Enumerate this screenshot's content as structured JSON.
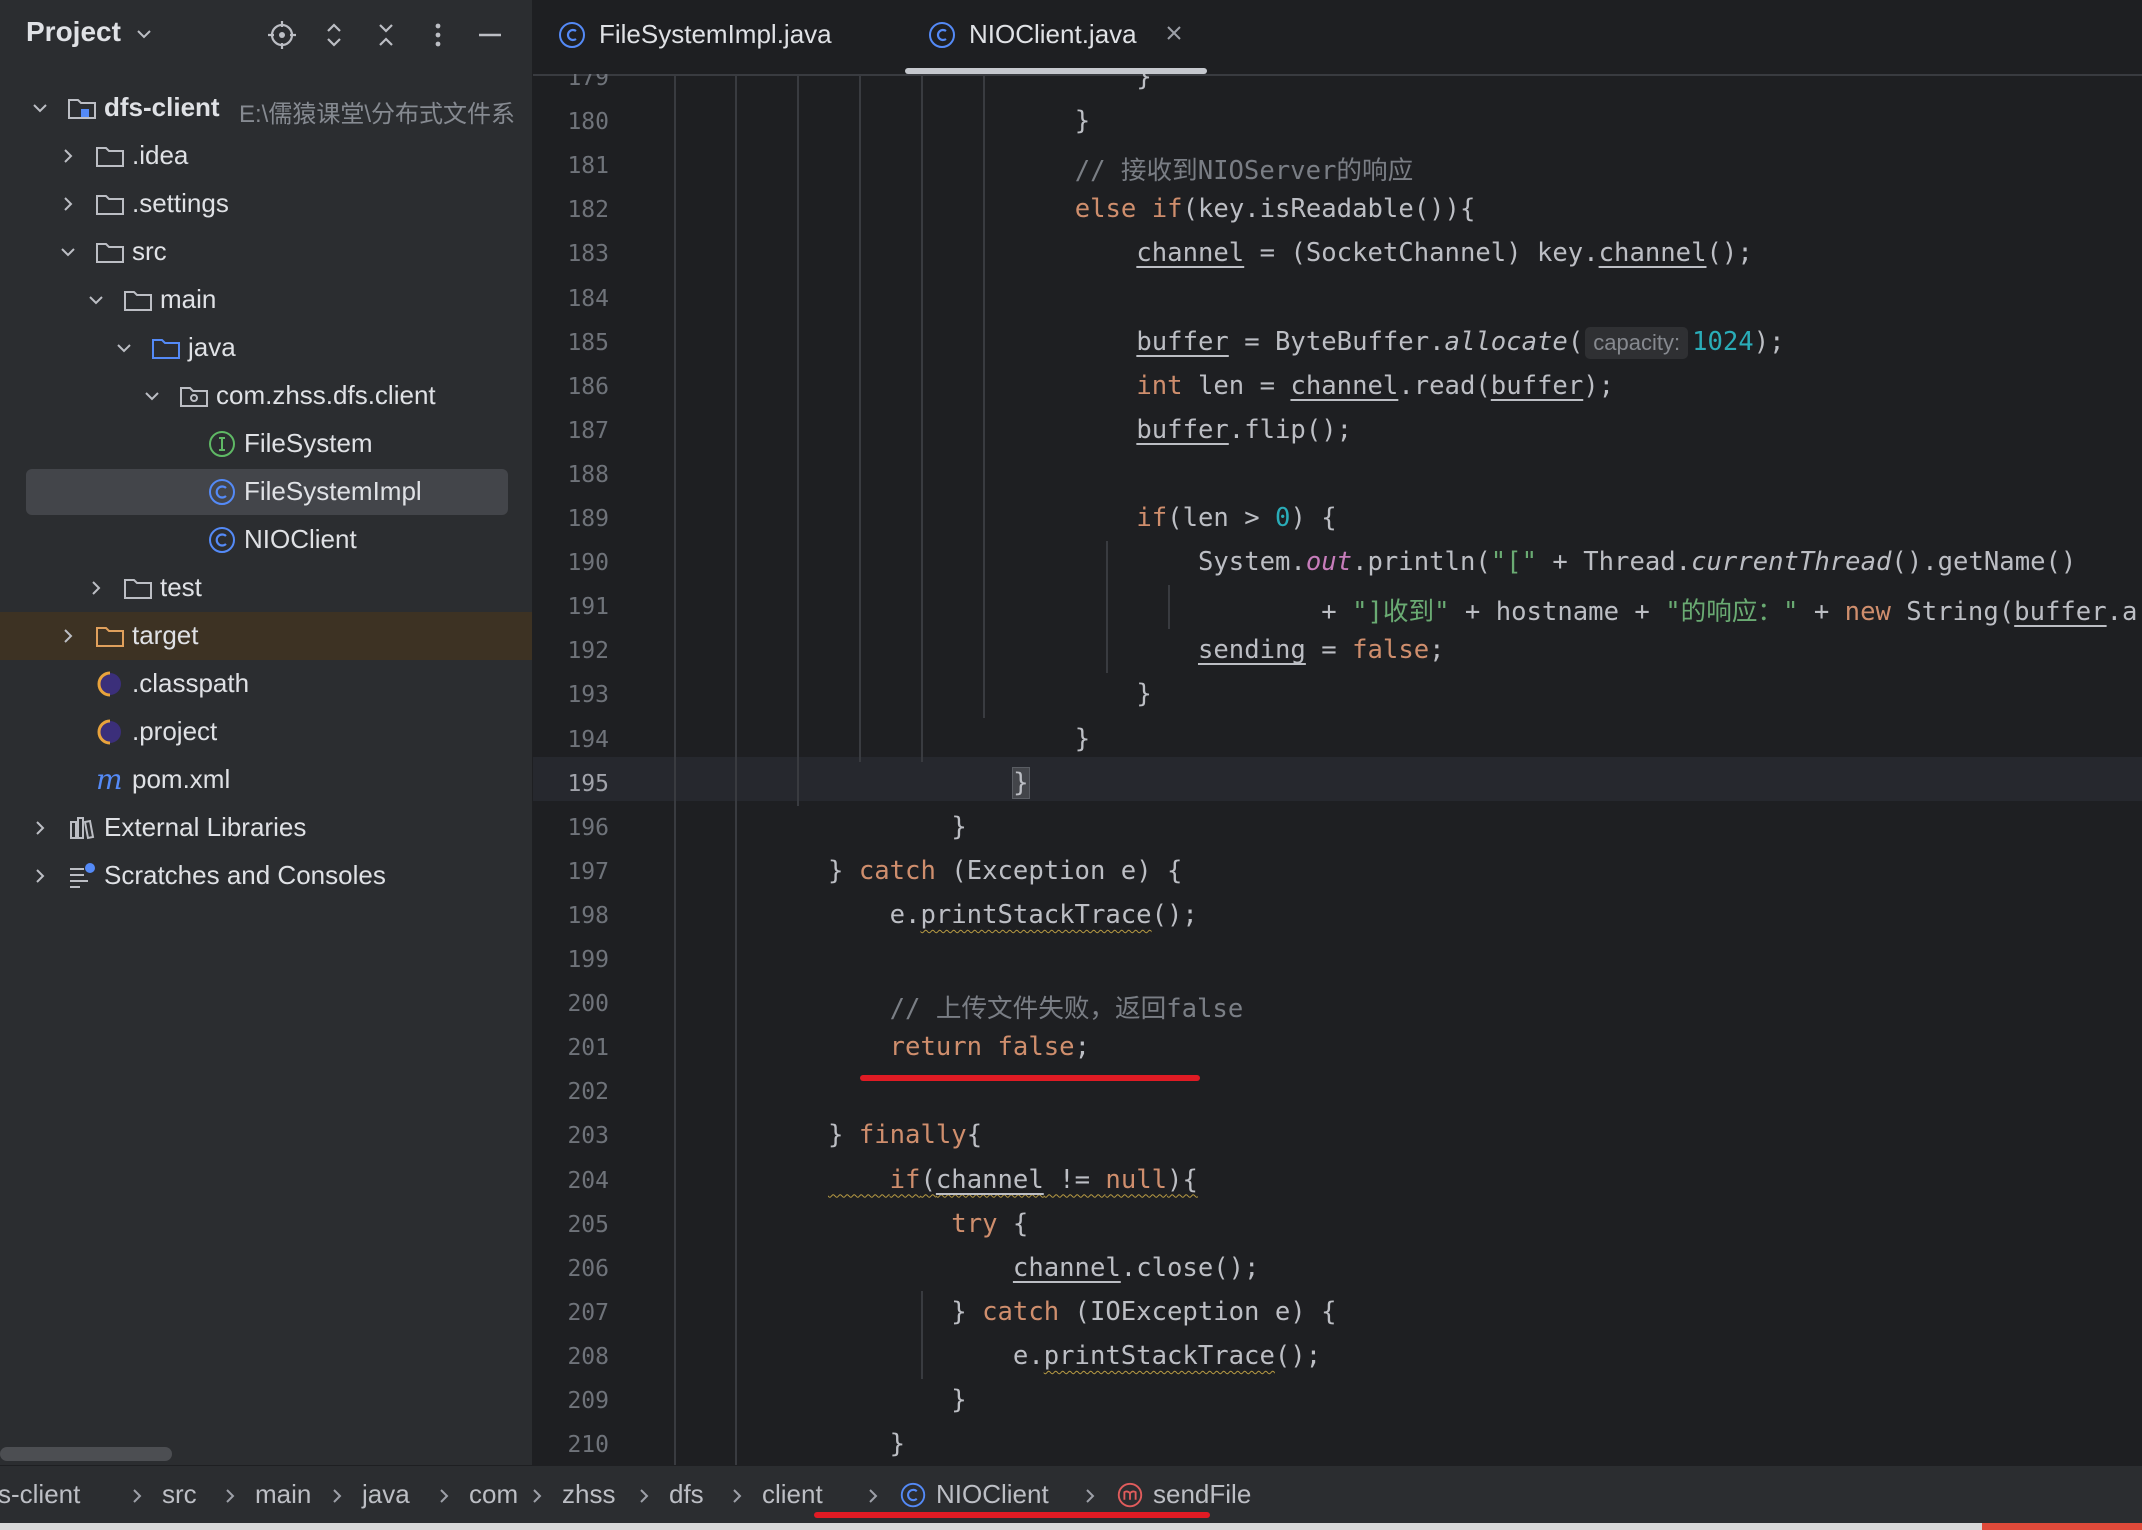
{
  "project_panel": {
    "title": "Project",
    "header_icons": [
      "locate-icon",
      "expand-all-icon",
      "collapse-all-icon",
      "more-icon",
      "hide-icon"
    ],
    "tree": [
      {
        "label": "dfs-client",
        "path": "E:\\儒猿课堂\\分布式文件系",
        "icon": "module-folder-icon",
        "depth": 0,
        "expanded": true,
        "bold": true
      },
      {
        "label": ".idea",
        "icon": "folder-icon",
        "depth": 1,
        "expanded": false
      },
      {
        "label": ".settings",
        "icon": "folder-icon",
        "depth": 1,
        "expanded": false
      },
      {
        "label": "src",
        "icon": "folder-icon",
        "depth": 1,
        "expanded": true
      },
      {
        "label": "main",
        "icon": "folder-icon",
        "depth": 2,
        "expanded": true
      },
      {
        "label": "java",
        "icon": "source-folder-icon",
        "depth": 3,
        "expanded": true
      },
      {
        "label": "com.zhss.dfs.client",
        "icon": "package-icon",
        "depth": 4,
        "expanded": true
      },
      {
        "label": "FileSystem",
        "icon": "interface-icon",
        "depth": 5
      },
      {
        "label": "FileSystemImpl",
        "icon": "class-icon",
        "depth": 5,
        "selected": true
      },
      {
        "label": "NIOClient",
        "icon": "class-icon",
        "depth": 5
      },
      {
        "label": "test",
        "icon": "folder-icon",
        "depth": 2,
        "expanded": false
      },
      {
        "label": "target",
        "icon": "excluded-folder-icon",
        "depth": 1,
        "expanded": false,
        "excluded": true
      },
      {
        "label": ".classpath",
        "icon": "eclipse-icon",
        "depth": 1
      },
      {
        "label": ".project",
        "icon": "eclipse-icon",
        "depth": 1
      },
      {
        "label": "pom.xml",
        "icon": "maven-icon",
        "depth": 1
      },
      {
        "label": "External Libraries",
        "icon": "libraries-icon",
        "depth": 0,
        "expanded": false
      },
      {
        "label": "Scratches and Consoles",
        "icon": "scratches-icon",
        "depth": 0,
        "expanded": false
      }
    ]
  },
  "editor": {
    "tabs": [
      {
        "label": "FileSystemImpl.java",
        "icon": "class-icon",
        "active": false
      },
      {
        "label": "NIOClient.java",
        "icon": "class-icon",
        "active": true,
        "closable": true
      }
    ],
    "current_line": 195,
    "first_line": 179,
    "lines": [
      {
        "n": 179,
        "t": "                }"
      },
      {
        "n": 180,
        "t": "            }"
      },
      {
        "n": 181,
        "t": "            // 接收到NIOServer的响应"
      },
      {
        "n": 182,
        "t": "            else if(key.isReadable()){"
      },
      {
        "n": 183,
        "t": "                channel = (SocketChannel) key.channel();"
      },
      {
        "n": 184,
        "t": ""
      },
      {
        "n": 185,
        "t": "                buffer = ByteBuffer.allocate( capacity: 1024);"
      },
      {
        "n": 186,
        "t": "                int len = channel.read(buffer);"
      },
      {
        "n": 187,
        "t": "                buffer.flip();"
      },
      {
        "n": 188,
        "t": ""
      },
      {
        "n": 189,
        "t": "                if(len > 0) {"
      },
      {
        "n": 190,
        "t": "                    System.out.println(\"[\" + Thread.currentThread().getName()"
      },
      {
        "n": 191,
        "t": "                            + \"]收到\" + hostname + \"的响应：\" + new String(buffer.arra"
      },
      {
        "n": 192,
        "t": "                    sending = false;"
      },
      {
        "n": 193,
        "t": "                }"
      },
      {
        "n": 194,
        "t": "            }"
      },
      {
        "n": 195,
        "t": "        }"
      },
      {
        "n": 196,
        "t": "    }"
      },
      {
        "n": 197,
        "t": "} catch (Exception e) {"
      },
      {
        "n": 198,
        "t": "    e.printStackTrace();"
      },
      {
        "n": 199,
        "t": ""
      },
      {
        "n": 200,
        "t": "    // 上传文件失败，返回false"
      },
      {
        "n": 201,
        "t": "    return false;"
      },
      {
        "n": 202,
        "t": ""
      },
      {
        "n": 203,
        "t": "} finally{"
      },
      {
        "n": 204,
        "t": "    if(channel != null){"
      },
      {
        "n": 205,
        "t": "        try {"
      },
      {
        "n": 206,
        "t": "            channel.close();"
      },
      {
        "n": 207,
        "t": "        } catch (IOException e) {"
      },
      {
        "n": 208,
        "t": "            e.printStackTrace();"
      },
      {
        "n": 209,
        "t": "        }"
      },
      {
        "n": 210,
        "t": "    }"
      }
    ]
  },
  "breadcrumb": [
    {
      "label": "s-client"
    },
    {
      "label": "src"
    },
    {
      "label": "main"
    },
    {
      "label": "java"
    },
    {
      "label": "com"
    },
    {
      "label": "zhss"
    },
    {
      "label": "dfs"
    },
    {
      "label": "client"
    },
    {
      "label": "NIOClient",
      "icon": "class-icon"
    },
    {
      "label": "sendFile",
      "icon": "method-icon"
    }
  ],
  "colors": {
    "keyword": "#cf8e6d",
    "comment": "#7a7e85",
    "string": "#6aab73",
    "number": "#2aacb8",
    "static_field": "#c77dbb",
    "class_icon": "#548af7",
    "interface_icon": "#5fb865",
    "method_icon": "#e05c5c",
    "annotation_red": "#e01b24"
  }
}
